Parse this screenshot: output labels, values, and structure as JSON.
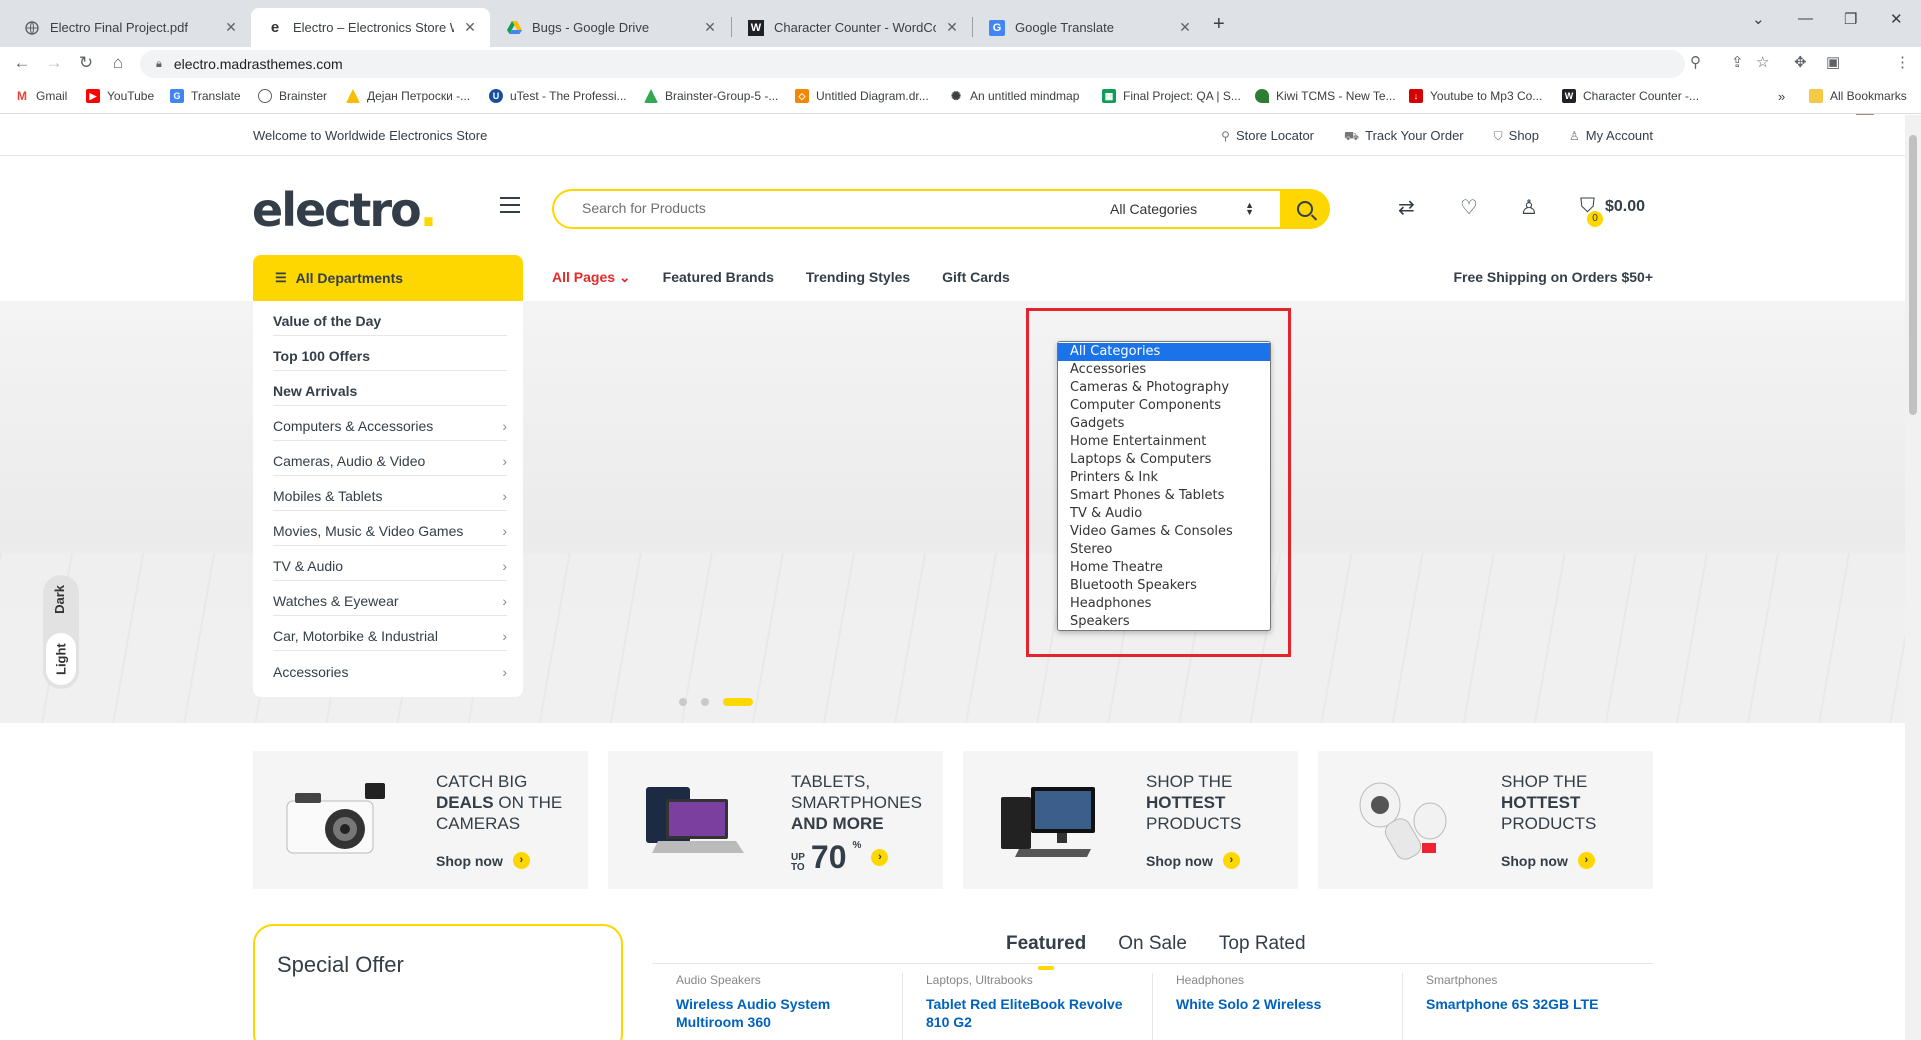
{
  "browser": {
    "tabs": [
      {
        "title": "Electro Final Project.pdf",
        "icon": "globe-icon"
      },
      {
        "title": "Electro – Electronics Store WooC",
        "icon": "electro-e-icon"
      },
      {
        "title": "Bugs - Google Drive",
        "icon": "google-drive-icon"
      },
      {
        "title": "Character Counter - WordCount",
        "icon": "wordcounter-w-icon"
      },
      {
        "title": "Google Translate",
        "icon": "google-translate-icon"
      }
    ],
    "url": "electro.madrasthemes.com",
    "bookmarks": [
      {
        "label": "Gmail",
        "color": "#ea4335"
      },
      {
        "label": "YouTube",
        "color": "#ff0000"
      },
      {
        "label": "Translate",
        "color": "#4285f4"
      },
      {
        "label": "Brainster",
        "color": "#5f6368"
      },
      {
        "label": "Дејан Петроски -...",
        "color": "#fbbc04"
      },
      {
        "label": "uTest - The Professi...",
        "color": "#1a4fa0"
      },
      {
        "label": "Brainster-Group-5 -...",
        "color": "#34a853"
      },
      {
        "label": "Untitled Diagram.dr...",
        "color": "#f08705"
      },
      {
        "label": "An untitled mindmap",
        "color": "#3c4043"
      },
      {
        "label": "Final Project: QA | S...",
        "color": "#0f9d58"
      },
      {
        "label": "Kiwi TCMS - New Te...",
        "color": "#2e7d32"
      },
      {
        "label": "Youtube to Mp3 Co...",
        "color": "#d50000"
      },
      {
        "label": "Character Counter -...",
        "color": "#202124"
      }
    ],
    "all_bookmarks": "All Bookmarks"
  },
  "site": {
    "welcome": "Welcome to Worldwide Electronics Store",
    "top_links": [
      "Store Locator",
      "Track Your Order",
      "Shop",
      "My Account"
    ],
    "logo": "electro",
    "logo_dot": ".",
    "search_placeholder": "Search for Products",
    "category_selected": "All Categories",
    "cart_count": "0",
    "cart_total": "$0.00",
    "all_departments": "All Departments",
    "nav_links": [
      "All Pages",
      "Featured Brands",
      "Trending Styles",
      "Gift Cards"
    ],
    "free_shipping": "Free Shipping on Orders $50+",
    "departments": [
      "Value of the Day",
      "Top 100 Offers",
      "New Arrivals",
      "Computers & Accessories",
      "Cameras, Audio & Video",
      "Mobiles & Tablets",
      "Movies, Music & Video Games",
      "TV & Audio",
      "Watches & Eyewear",
      "Car, Motorbike & Industrial",
      "Accessories"
    ],
    "theme_dark": "Dark",
    "theme_light": "Light",
    "slider_active_index": 3,
    "banners": [
      {
        "line1": "CATCH BIG",
        "bold": "DEALS",
        "line2": "ON THE",
        "line3": "CAMERAS",
        "shop": "Shop now"
      },
      {
        "line1": "TABLETS,",
        "line2": "SMARTPHONES",
        "bold": "AND MORE",
        "up": "UP",
        "to": "TO",
        "pct": "70",
        "pct_sign": "%"
      },
      {
        "line1": "SHOP THE",
        "bold": "HOTTEST",
        "line3": "PRODUCTS",
        "shop": "Shop now"
      },
      {
        "line1": "SHOP THE",
        "bold": "HOTTEST",
        "line3": "PRODUCTS",
        "shop": "Shop now"
      }
    ],
    "special_offer": "Special Offer",
    "product_tabs": [
      "Featured",
      "On Sale",
      "Top Rated"
    ],
    "products": [
      {
        "category": "Audio Speakers",
        "name": "Wireless Audio System Multiroom 360"
      },
      {
        "category": "Laptops, Ultrabooks",
        "name": "Tablet Red EliteBook Revolve 810 G2"
      },
      {
        "category": "Headphones",
        "name": "White Solo 2 Wireless"
      },
      {
        "category": "Smartphones",
        "name": "Smartphone 6S 32GB LTE"
      }
    ],
    "dropdown_options": [
      "All Categories",
      "Accessories",
      "Cameras & Photography",
      "Computer Components",
      "Gadgets",
      "Home Entertainment",
      "Laptops & Computers",
      "Printers & Ink",
      "Smart Phones & Tablets",
      "TV & Audio",
      "Video Games & Consoles",
      "Stereo",
      "Home Theatre",
      "Bluetooth Speakers",
      "Headphones",
      "Speakers"
    ],
    "accent_color": "#fed700",
    "highlight_color": "#e3242b"
  }
}
